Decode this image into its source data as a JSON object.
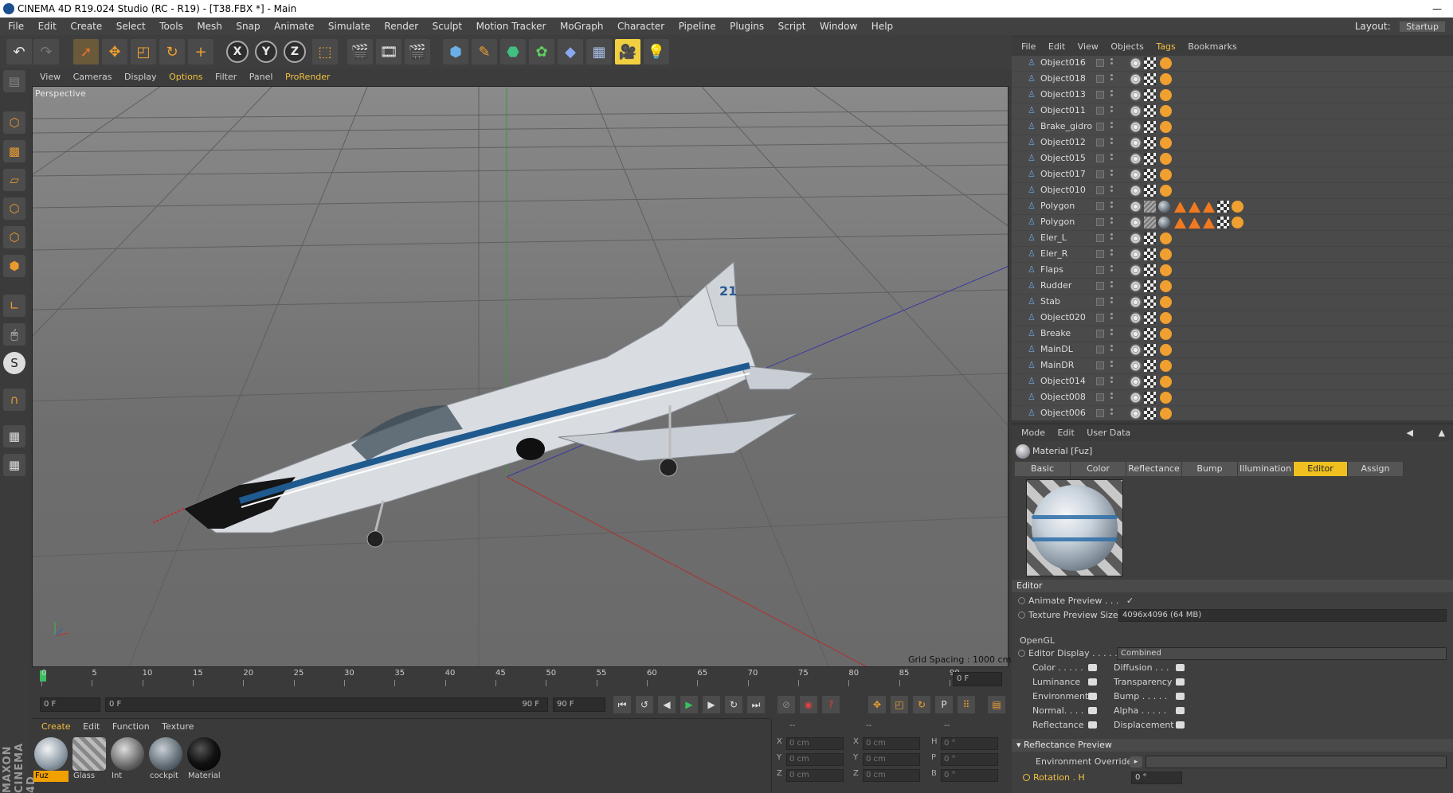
{
  "window": {
    "title": "CINEMA 4D R19.024 Studio (RC - R19) - [T38.FBX *] - Main",
    "minimize": "—"
  },
  "menubar": {
    "items": [
      "File",
      "Edit",
      "Create",
      "Select",
      "Tools",
      "Mesh",
      "Snap",
      "Animate",
      "Simulate",
      "Render",
      "Sculpt",
      "Motion Tracker",
      "MoGraph",
      "Character",
      "Pipeline",
      "Plugins",
      "Script",
      "Window",
      "Help"
    ],
    "layout_label": "Layout:",
    "layout_value": "Startup"
  },
  "toolbar": {
    "axis_x": "X",
    "axis_y": "Y",
    "axis_z": "Z"
  },
  "viewport": {
    "menu": [
      "View",
      "Cameras",
      "Display",
      "Options",
      "Filter",
      "Panel",
      "ProRender"
    ],
    "label": "Perspective",
    "grid_spacing": "Grid Spacing : 1000 cm",
    "tail_number": "21"
  },
  "timeline": {
    "ticks": [
      "0",
      "5",
      "10",
      "15",
      "20",
      "25",
      "30",
      "35",
      "40",
      "45",
      "50",
      "55",
      "60",
      "65",
      "70",
      "75",
      "80",
      "85",
      "90"
    ],
    "current_frame_field": "0 F",
    "start_field": "0 F",
    "range_start": "0 F",
    "range_end": "90 F",
    "end_field": "90 F"
  },
  "materials": {
    "menu": [
      "Create",
      "Edit",
      "Function",
      "Texture"
    ],
    "items": [
      {
        "name": "Fuz"
      },
      {
        "name": "Glass"
      },
      {
        "name": "Int"
      },
      {
        "name": "cockpit"
      },
      {
        "name": "Material"
      }
    ]
  },
  "coords": {
    "headers": [
      "--",
      "--",
      "--"
    ],
    "rows": [
      {
        "a": "X",
        "av": "0 cm",
        "b": "X",
        "bv": "0 cm",
        "c": "H",
        "cv": "0 °"
      },
      {
        "a": "Y",
        "av": "0 cm",
        "b": "Y",
        "bv": "0 cm",
        "c": "P",
        "cv": "0 °"
      },
      {
        "a": "Z",
        "av": "0 cm",
        "b": "Z",
        "bv": "0 cm",
        "c": "B",
        "cv": "0 °"
      }
    ]
  },
  "objects": {
    "menu": [
      "File",
      "Edit",
      "View",
      "Objects",
      "Tags",
      "Bookmarks"
    ],
    "rows": [
      {
        "name": "Object016",
        "type": "normal"
      },
      {
        "name": "Object018",
        "type": "normal"
      },
      {
        "name": "Object013",
        "type": "normal"
      },
      {
        "name": "Object011",
        "type": "normal"
      },
      {
        "name": "Brake_gidro",
        "type": "normal"
      },
      {
        "name": "Object012",
        "type": "normal"
      },
      {
        "name": "Object015",
        "type": "normal"
      },
      {
        "name": "Object017",
        "type": "normal"
      },
      {
        "name": "Object010",
        "type": "normal"
      },
      {
        "name": "Polygon",
        "type": "polygon"
      },
      {
        "name": "Polygon",
        "type": "polygon"
      },
      {
        "name": "Eler_L",
        "type": "normal"
      },
      {
        "name": "Eler_R",
        "type": "normal"
      },
      {
        "name": "Flaps",
        "type": "normal"
      },
      {
        "name": "Rudder",
        "type": "normal"
      },
      {
        "name": "Stab",
        "type": "normal"
      },
      {
        "name": "Object020",
        "type": "normal"
      },
      {
        "name": "Breake",
        "type": "normal"
      },
      {
        "name": "MainDL",
        "type": "normal"
      },
      {
        "name": "MainDR",
        "type": "normal"
      },
      {
        "name": "Object014",
        "type": "normal"
      },
      {
        "name": "Object008",
        "type": "normal"
      },
      {
        "name": "Object006",
        "type": "normal"
      }
    ]
  },
  "attributes": {
    "menu": [
      "Mode",
      "Edit",
      "User Data"
    ],
    "title": "Material [Fuz]",
    "tabs": [
      "Basic",
      "Color",
      "Reflectance",
      "Bump",
      "Illumination",
      "Editor",
      "Assign"
    ],
    "active_tab": "Editor",
    "editor_header": "Editor",
    "animate_preview": "Animate Preview . . .",
    "animate_preview_value": "✓",
    "texture_preview_size": "Texture Preview Size",
    "texture_preview_value": "4096x4096 (64 MB)",
    "opengl": "OpenGL",
    "editor_display": "Editor Display . . . . .",
    "editor_display_value": "Combined",
    "channels_left": [
      "Color . . . . .",
      "Luminance",
      "Environment",
      "Normal. . . .",
      "Reflectance"
    ],
    "channels_right": [
      "Diffusion . . .",
      "Transparency",
      "Bump . . . . .",
      "Alpha . . . . .",
      "Displacement"
    ],
    "reflectance_preview": "Reflectance Preview",
    "environment_override": "Environment Override",
    "rotation_h": "Rotation . H",
    "rotation_h_value": "0 °"
  },
  "brand": "MAXON CINEMA 4D"
}
